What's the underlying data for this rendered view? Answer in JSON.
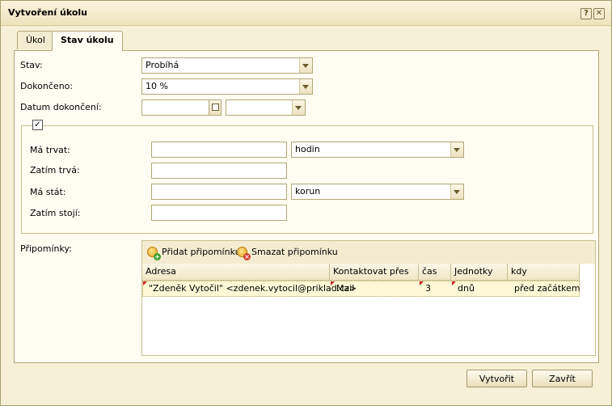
{
  "window": {
    "title": "Vytvoření úkolu",
    "help_label": "?",
    "close_label": "✕"
  },
  "tabs": [
    {
      "label": "Úkol"
    },
    {
      "label": "Stav úkolu"
    }
  ],
  "form": {
    "stav_label": "Stav:",
    "stav_value": "Probíhá",
    "dokonceno_label": "Dokončeno:",
    "dokonceno_value": "10 %",
    "datum_label": "Datum dokončení:",
    "datum_value": "",
    "datum_time_value": ""
  },
  "fieldset": {
    "checkbox_checked": "✓",
    "ma_trvat_label": "Má trvat:",
    "ma_trvat_value": "",
    "ma_trvat_unit": "hodin",
    "zatim_trva_label": "Zatím trvá:",
    "zatim_trva_value": "",
    "ma_stat_label": "Má stát:",
    "ma_stat_value": "",
    "ma_stat_unit": "korun",
    "zatim_stoji_label": "Zatím stojí:",
    "zatim_stoji_value": ""
  },
  "reminders": {
    "label": "Připomínky:",
    "add_label": "Přidat připomínku",
    "delete_label": "Smazat připomínku",
    "columns": [
      "Adresa",
      "Kontaktovat přes",
      "čas",
      "Jednotky",
      "kdy"
    ],
    "rows": [
      [
        "\"Zdeněk Vytočil\" <zdenek.vytocil@priklad.cz>",
        "Mail",
        "3",
        "dnů",
        "před začátkem"
      ]
    ]
  },
  "buttons": {
    "create_label": "Vytvořit",
    "close_label": "Zavřít"
  }
}
